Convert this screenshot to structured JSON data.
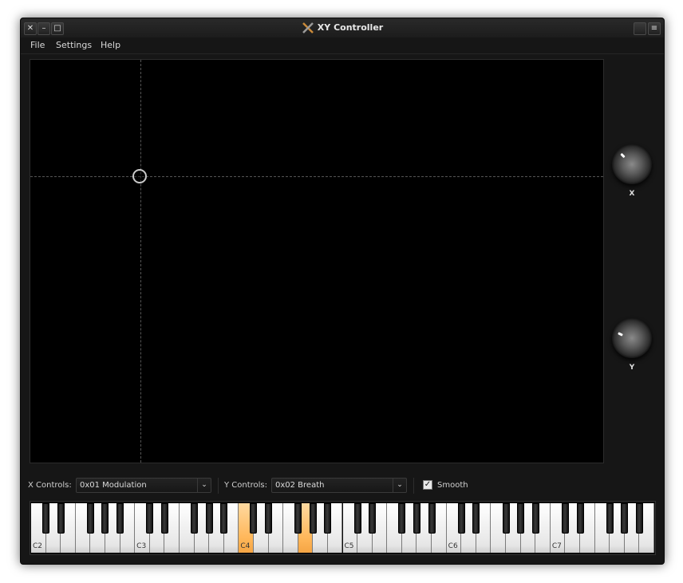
{
  "window": {
    "title": "XY Controller",
    "close_glyph": "✕",
    "minimize_glyph": "–",
    "maximize_glyph": "□",
    "menu_glyph": "≡"
  },
  "menu": [
    "File",
    "Settings",
    "Help"
  ],
  "knobs": {
    "x_label": "X",
    "y_label": "Y"
  },
  "controls": {
    "x_label": "X Controls:",
    "x_value": "0x01 Modulation",
    "y_label": "Y Controls:",
    "y_value": "0x02 Breath",
    "smooth_label": "Smooth",
    "smooth_checked": true,
    "checkmark": "✓",
    "dropdown_arrow": "⌄"
  },
  "piano": {
    "octave_labels": [
      "C2",
      "C3",
      "C4",
      "C5",
      "C6",
      "C7"
    ],
    "active_white_keys": [
      14,
      18
    ]
  },
  "colors": {
    "key_highlight": "#ffb75a"
  }
}
